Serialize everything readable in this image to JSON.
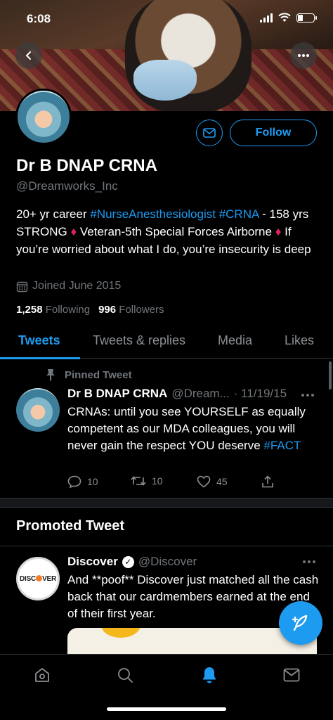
{
  "status_bar": {
    "time": "6:08"
  },
  "header": {
    "back_icon": "chevron-left-icon",
    "more_icon": "more-horizontal-icon"
  },
  "profile": {
    "display_name": "Dr B DNAP CRNA",
    "handle": "@Dreamworks_Inc",
    "follow_label": "Follow",
    "bio_parts": {
      "p1": "20+ yr career ",
      "h1": "#NurseAnesthesiologist",
      "p2": " ",
      "h2": "#CRNA",
      "p3": " - 158 yrs STRONG ",
      "d1": "♦",
      "p4": " Veteran-5th Special Forces Airborne ",
      "d2": "♦",
      "p5": " If you’re worried about what I do, you’re insecurity is deep"
    },
    "joined": "Joined June 2015",
    "following_count": "1,258",
    "following_label": "Following",
    "followers_count": "996",
    "followers_label": "Followers"
  },
  "tabs": [
    {
      "label": "Tweets",
      "active": true
    },
    {
      "label": "Tweets & replies",
      "active": false
    },
    {
      "label": "Media",
      "active": false
    },
    {
      "label": "Likes",
      "active": false
    }
  ],
  "pinned_tweet": {
    "pinned_label": "Pinned Tweet",
    "author_name": "Dr B DNAP CRNA",
    "author_handle": "@Dream...",
    "date": "· 11/19/15",
    "text": "CRNAs: until you see YOURSELF as equally competent as our MDA colleagues, you will never gain the respect YOU deserve ",
    "hashtag": "#FACT",
    "replies": "10",
    "retweets": "10",
    "likes": "45"
  },
  "promoted": {
    "section_title": "Promoted Tweet",
    "author_name": "Discover",
    "author_handle": "@Discover",
    "logo_text_a": "DISC",
    "logo_text_b": "VER",
    "text": "And **poof** Discover just matched all the cash back that our cardmembers earned at the end of their first year."
  },
  "bottom_nav": {
    "items": [
      "home-icon",
      "search-icon",
      "notifications-icon",
      "messages-icon"
    ],
    "active": "notifications-icon"
  },
  "colors": {
    "accent": "#1d9bf0",
    "muted": "#71767b",
    "background": "#000000",
    "diamond": "#e0245e"
  }
}
